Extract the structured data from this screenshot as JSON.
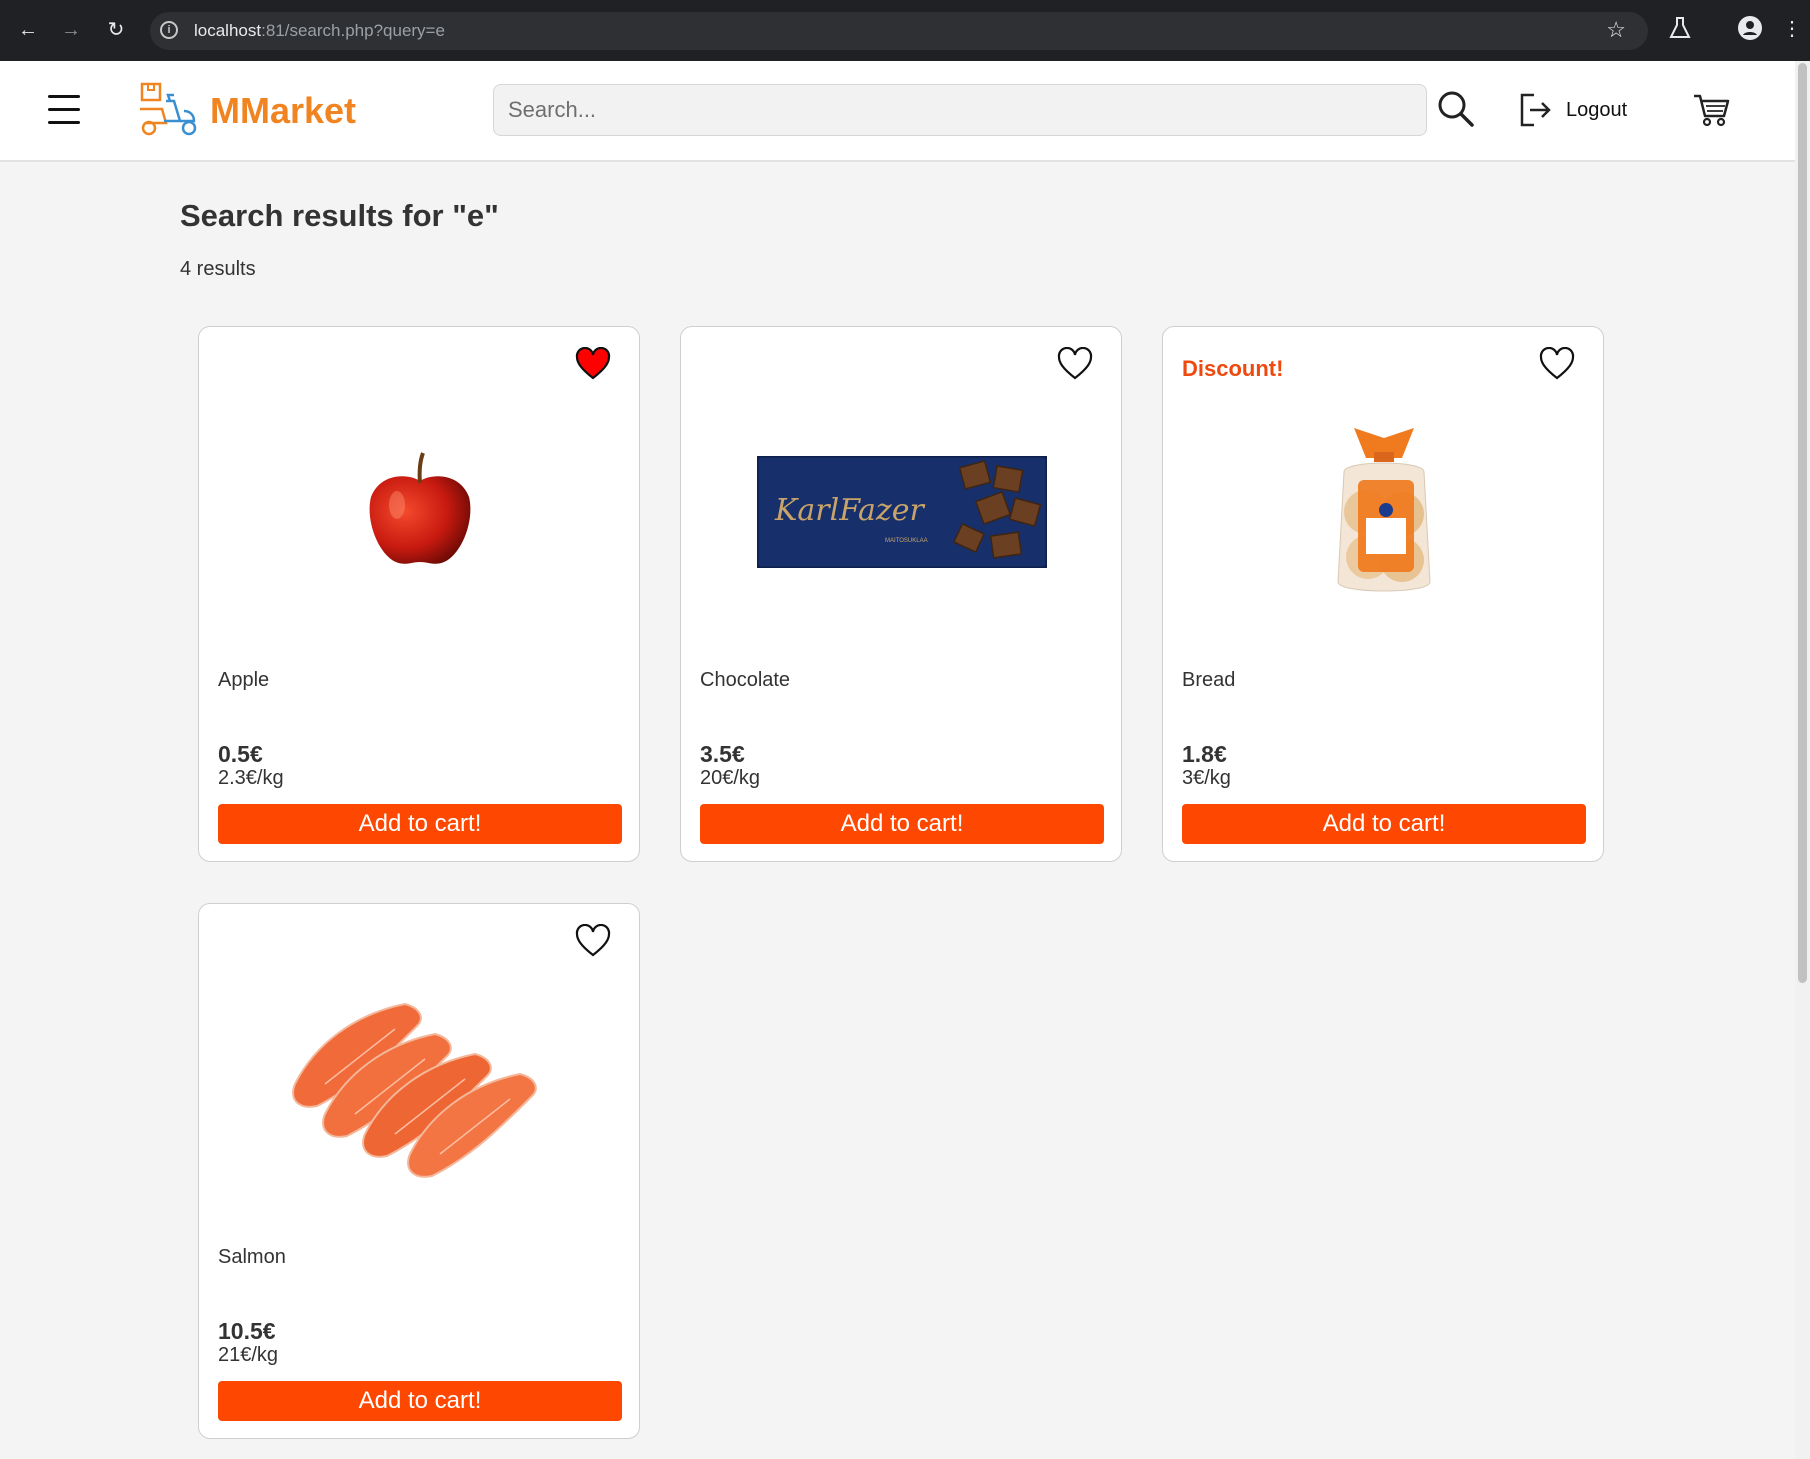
{
  "browser": {
    "url_host": "localhost",
    "url_rest": ":81/search.php?query=e"
  },
  "header": {
    "brand": "MMarket",
    "search_placeholder": "Search...",
    "logout_label": "Logout"
  },
  "main": {
    "title": "Search results for \"e\"",
    "results_count": "4 results"
  },
  "products": [
    {
      "name": "Apple",
      "price": "0.5€",
      "unit_price": "2.3€/kg",
      "button": "Add to cart!",
      "favorited": true,
      "discount": ""
    },
    {
      "name": "Chocolate",
      "price": "3.5€",
      "unit_price": "20€/kg",
      "button": "Add to cart!",
      "favorited": false,
      "discount": ""
    },
    {
      "name": "Bread",
      "price": "1.8€",
      "unit_price": "3€/kg",
      "button": "Add to cart!",
      "favorited": false,
      "discount": "Discount!"
    },
    {
      "name": "Salmon",
      "price": "10.5€",
      "unit_price": "21€/kg",
      "button": "Add to cart!",
      "favorited": false,
      "discount": ""
    }
  ],
  "chocolate_wrapper": {
    "brand": "KarlFazer",
    "sub": "MAITOSUKLAA"
  },
  "colors": {
    "brand": "#f08421",
    "accent": "#fe4801",
    "discount": "#ee4a10",
    "heart_fill": "#ff0000"
  }
}
